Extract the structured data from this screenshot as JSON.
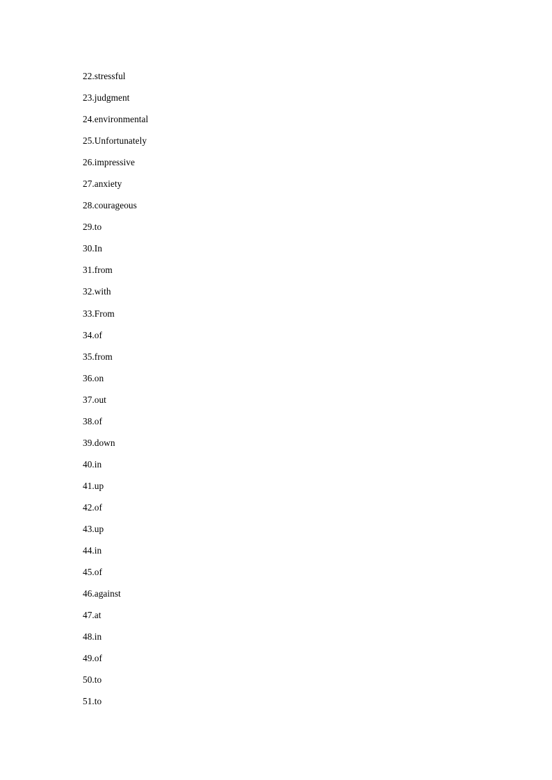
{
  "document": {
    "type": "answer-key-list",
    "page_background": "#ffffff",
    "text_color": "#000000",
    "items": [
      {
        "number": "22.",
        "answer": "stressful"
      },
      {
        "number": "23.",
        "answer": "judgment"
      },
      {
        "number": "24.",
        "answer": "environmental"
      },
      {
        "number": "25.",
        "answer": "Unfortunately"
      },
      {
        "number": "26.",
        "answer": "impressive"
      },
      {
        "number": "27.",
        "answer": "anxiety"
      },
      {
        "number": "28.",
        "answer": "courageous"
      },
      {
        "number": "29.",
        "answer": "to"
      },
      {
        "number": "30.",
        "answer": "In"
      },
      {
        "number": "31.",
        "answer": "from"
      },
      {
        "number": "32.",
        "answer": "with"
      },
      {
        "number": "33.",
        "answer": "From"
      },
      {
        "number": "34.",
        "answer": "of"
      },
      {
        "number": "35.",
        "answer": "from"
      },
      {
        "number": "36.",
        "answer": "on"
      },
      {
        "number": "37.",
        "answer": "out"
      },
      {
        "number": "38.",
        "answer": "of"
      },
      {
        "number": "39.",
        "answer": "down"
      },
      {
        "number": "40.",
        "answer": "in"
      },
      {
        "number": "41.",
        "answer": "up"
      },
      {
        "number": "42.",
        "answer": "of"
      },
      {
        "number": "43.",
        "answer": "up"
      },
      {
        "number": "44.",
        "answer": "in"
      },
      {
        "number": "45.",
        "answer": "of"
      },
      {
        "number": "46.",
        "answer": "against"
      },
      {
        "number": "47.",
        "answer": "at"
      },
      {
        "number": "48.",
        "answer": "in"
      },
      {
        "number": "49.",
        "answer": "of"
      },
      {
        "number": "50.",
        "answer": "to"
      },
      {
        "number": "51.",
        "answer": "to"
      }
    ]
  }
}
